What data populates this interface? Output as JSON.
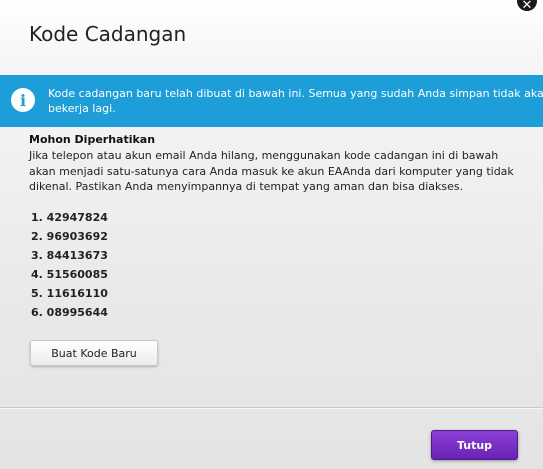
{
  "dialog": {
    "title": "Kode Cadangan",
    "close_icon": "close-icon"
  },
  "info_banner": {
    "icon": "info-icon",
    "icon_glyph": "i",
    "text": "Kode cadangan baru telah dibuat di bawah ini. Semua yang sudah Anda simpan tidak akan bekerja lagi.",
    "background": "#1e9ed8"
  },
  "notice": {
    "heading": "Mohon Diperhatikan",
    "body": "Jika telepon atau akun email Anda hilang, menggunakan kode cadangan ini di bawah akan menjadi satu-satunya cara Anda masuk ke akun EAAnda dari komputer yang tidak dikenal. Pastikan Anda menyimpannya di tempat yang aman dan bisa diakses."
  },
  "codes": [
    "1. 42947824",
    "2. 96903692",
    "3. 84413673",
    "4. 51560085",
    "5. 11616110",
    "6. 08995644"
  ],
  "buttons": {
    "new_code": "Buat Kode Baru",
    "close": "Tutup",
    "close_color": "#7330c4"
  }
}
